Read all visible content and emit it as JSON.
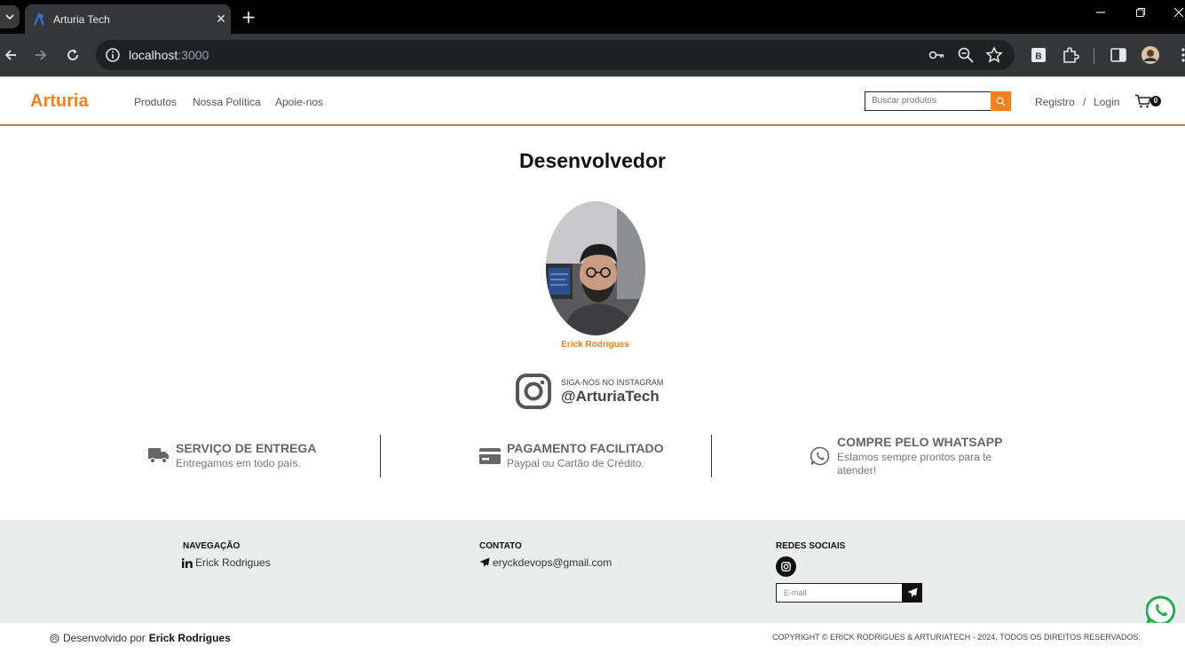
{
  "browser": {
    "tab_title": "Arturia Tech",
    "url_host": "localhost",
    "url_port": ":3000",
    "new_tab_label": "+",
    "close_label": "✕"
  },
  "header": {
    "logo": "Arturia",
    "nav": [
      "Produtos",
      "Nossa Política",
      "Apoie-nos"
    ],
    "search_placeholder": "Buscar produtos",
    "register": "Registro",
    "separator": "/",
    "login": "Login",
    "cart_count": "0"
  },
  "main": {
    "title": "Desenvolvedor",
    "developer_name": "Erick Rodrigues",
    "instagram_caption": "SIGA-NOS NO INSTAGRAM",
    "instagram_handle": "@ArturiaTech"
  },
  "features": [
    {
      "title": "SERVIÇO DE ENTREGA",
      "desc": "Entregamos em todo país.",
      "icon": "truck-icon"
    },
    {
      "title": "PAGAMENTO FACILITADO",
      "desc": "Paypal ou Cartão de Crédito.",
      "icon": "credit-card-icon"
    },
    {
      "title": "COMPRE PELO WHATSAPP",
      "desc1": "Estamos sempre prontos para te",
      "desc2": "atender!",
      "icon": "whatsapp-icon"
    }
  ],
  "footer": {
    "nav_heading": "NAVEGAÇÃO",
    "nav_link": "Erick Rodrigues",
    "contact_heading": "CONTATO",
    "contact_email": "eryckdevops@gmail.com",
    "social_heading": "REDES SOCIAIS",
    "email_placeholder": "E-mail"
  },
  "bottom": {
    "credit_prefix": "Desenvolvido por",
    "credit_name": "Erick Rodrigues",
    "copyright": "COPYRIGHT © ERICK RODRIGUES & ARTURIATECH - 2024. TODOS OS DIREITOS RESERVADOS."
  },
  "colors": {
    "accent": "#f08122",
    "footer_bg": "#e9edec",
    "chrome_dark": "#35363a"
  }
}
